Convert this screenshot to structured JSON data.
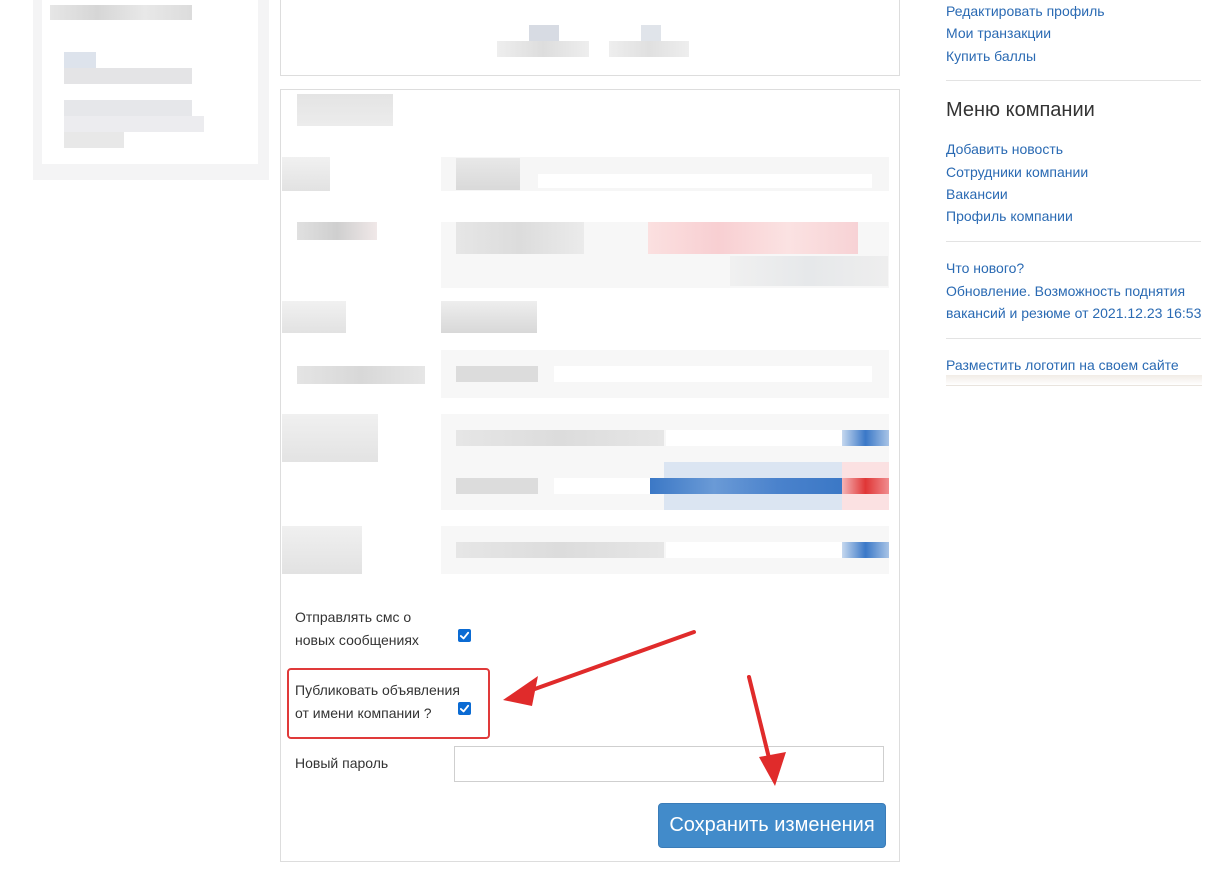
{
  "form": {
    "sms_label_line1": "Отправлять смс о",
    "sms_label_line2": "новых сообщениях",
    "sms_checked": true,
    "publish_label_line1": "Публиковать объявления",
    "publish_label_line2": "от имени компании ?",
    "publish_checked": true,
    "password_label": "Новый пароль",
    "password_value": "",
    "save_label": "Сохранить изменения"
  },
  "sidebar": {
    "top_links": [
      "Редактировать профиль",
      "Мои транзакции",
      "Купить баллы"
    ],
    "company_menu_title": "Меню компании",
    "company_links": [
      "Добавить новость",
      "Сотрудники компании",
      "Вакансии",
      "Профиль компании"
    ],
    "news_title": "Что нового?",
    "news_line1": "Обновление. Возможность поднятия",
    "news_line2": "вакансий и резюме от 2021.12.23 16:53",
    "logo_link": "Разместить логотип на своем сайте"
  },
  "colors": {
    "accent": "#428bca",
    "link": "#2a6ab3",
    "highlight": "#e03a3a",
    "checkbox": "#0b6bd3"
  }
}
